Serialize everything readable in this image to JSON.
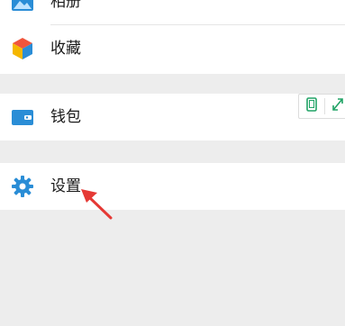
{
  "menu": {
    "album_label": "相册",
    "favorites_label": "收藏",
    "wallet_label": "钱包",
    "settings_label": "设置"
  },
  "icons": {
    "album": "image-icon",
    "favorites": "cube-icon",
    "wallet": "wallet-icon",
    "settings": "gear-icon",
    "tool_phone": "phone-frame-icon",
    "tool_expand": "expand-icon"
  },
  "colors": {
    "background": "#ededed",
    "row": "#ffffff",
    "icon_blue": "#2a8dd6",
    "annotation_arrow": "#e53935",
    "tool_green": "#21a366"
  }
}
